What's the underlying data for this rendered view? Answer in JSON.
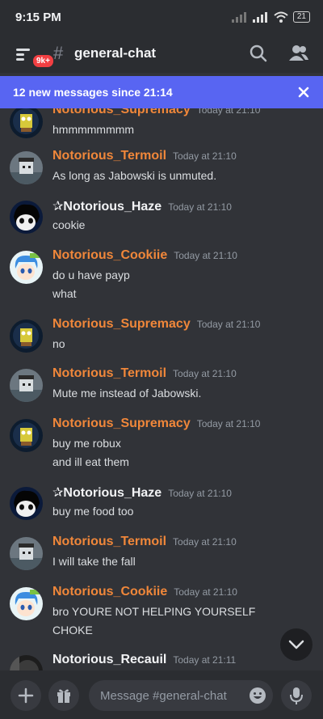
{
  "status_bar": {
    "time": "9:15 PM",
    "battery": "21"
  },
  "header": {
    "channel": "general-chat",
    "badge": "9k+"
  },
  "new_messages_banner": {
    "text": "12 new messages since 21:14"
  },
  "messages": [
    {
      "user": "Notorious_Supremacy",
      "time": "Today at 21:10",
      "lines": [
        "hmmmmmmmm"
      ],
      "avatar": "sponge",
      "color": "#f0873a"
    },
    {
      "user": "Notorious_Termoil",
      "time": "Today at 21:10",
      "lines": [
        "As long as Jabowski is unmuted."
      ],
      "avatar": "termoil",
      "color": "#f0873a"
    },
    {
      "user": "✰Notorious_Haze",
      "time": "Today at 21:10",
      "lines": [
        "cookie"
      ],
      "avatar": "haze",
      "color": "#f2f3f5"
    },
    {
      "user": "Notorious_Cookiie",
      "time": "Today at 21:10",
      "lines": [
        "do u have payp",
        "what"
      ],
      "avatar": "cookiie",
      "color": "#f0873a"
    },
    {
      "user": "Notorious_Supremacy",
      "time": "Today at 21:10",
      "lines": [
        "no"
      ],
      "avatar": "sponge",
      "color": "#f0873a"
    },
    {
      "user": "Notorious_Termoil",
      "time": "Today at 21:10",
      "lines": [
        "Mute me instead of Jabowski."
      ],
      "avatar": "termoil",
      "color": "#f0873a"
    },
    {
      "user": "Notorious_Supremacy",
      "time": "Today at 21:10",
      "lines": [
        "buy me robux",
        "and ill eat them"
      ],
      "avatar": "sponge",
      "color": "#f0873a"
    },
    {
      "user": "✰Notorious_Haze",
      "time": "Today at 21:10",
      "lines": [
        "buy me food too"
      ],
      "avatar": "haze",
      "color": "#f2f3f5"
    },
    {
      "user": "Notorious_Termoil",
      "time": "Today at 21:10",
      "lines": [
        "I will take the fall"
      ],
      "avatar": "termoil",
      "color": "#f0873a"
    },
    {
      "user": "Notorious_Cookiie",
      "time": "Today at 21:10",
      "lines": [
        "bro YOURE NOT HELPING YOURSELF",
        "CHOKE"
      ],
      "avatar": "cookiie",
      "color": "#f0873a"
    },
    {
      "user": "Notorious_Recauil",
      "time": "Today at 21:11",
      "lines": [],
      "avatar": "recauil",
      "color": "#f2f3f5"
    }
  ],
  "composer": {
    "placeholder": "Message #general-chat"
  },
  "colors": {
    "accent": "#5865f2",
    "username_orange": "#f0873a",
    "background": "#313338"
  }
}
